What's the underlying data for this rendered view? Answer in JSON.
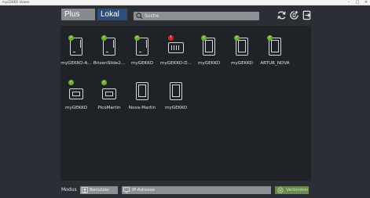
{
  "window": {
    "title": "myGEKKO Viewer",
    "controls": [
      "–",
      "□",
      "×"
    ]
  },
  "tabs": [
    {
      "label": "Plus",
      "active": false
    },
    {
      "label": "Lokal",
      "active": true
    }
  ],
  "search": {
    "placeholder": "Suche",
    "icon": "search-icon"
  },
  "toolbar": [
    {
      "name": "refresh-icon"
    },
    {
      "name": "add-device-icon"
    },
    {
      "name": "export-icon"
    }
  ],
  "devices": [
    {
      "label": "myGEKKO-A...",
      "type": "panel",
      "status": "ok"
    },
    {
      "label": "BrixenSlide2...",
      "type": "panel",
      "status": "ok"
    },
    {
      "label": "myGEKKO",
      "type": "panel",
      "status": "ok"
    },
    {
      "label": "myGEKKO-D...",
      "type": "controller",
      "status": "error"
    },
    {
      "label": "myGEKKO",
      "type": "tablet",
      "status": "ok"
    },
    {
      "label": "myGEKKO",
      "type": "tablet",
      "status": "ok"
    },
    {
      "label": "ARTUR_NOVA",
      "type": "tablet",
      "status": "ok"
    },
    {
      "label": "myGEKKO",
      "type": "box",
      "status": "ok"
    },
    {
      "label": "PicoMartin",
      "type": "box",
      "status": "ok"
    },
    {
      "label": "Nova-Martin",
      "type": "tablet",
      "status": "none"
    },
    {
      "label": "myGEKKO",
      "type": "tablet",
      "status": "none"
    }
  ],
  "footer": {
    "modus_label": "Modus",
    "mode_value": "Benutzer",
    "ip_placeholder": "IP-Adresse",
    "connect_label": "Verbinden"
  },
  "colors": {
    "background": "#2b2f35",
    "panel": "#1f2226",
    "tab_active": "#2d4d7a",
    "field": "#8c8f94",
    "ok_badge": "#68b32e",
    "error_badge": "#cc2a2a",
    "connect_button": "#6a8a4f"
  }
}
